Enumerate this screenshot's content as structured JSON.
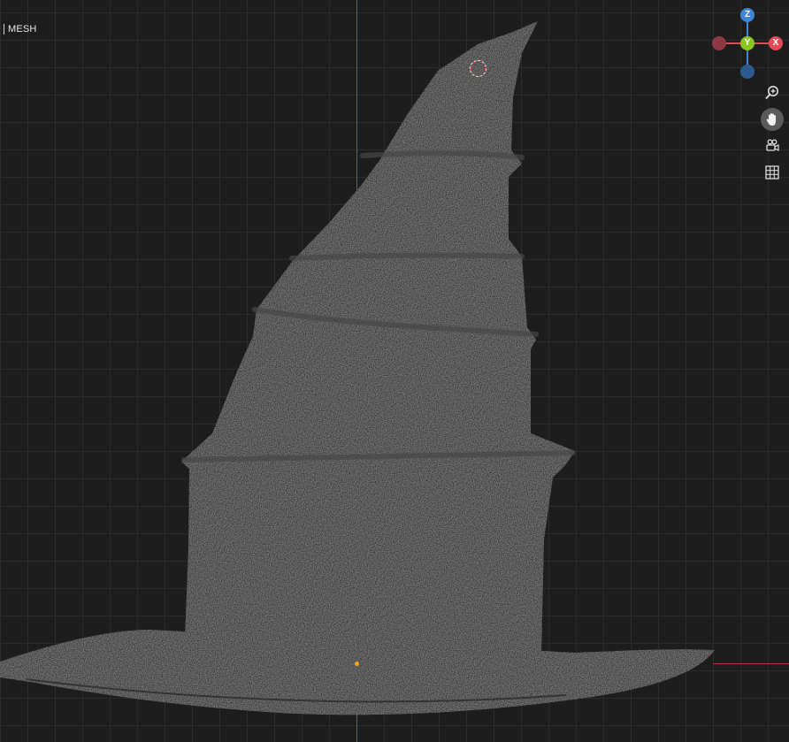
{
  "viewport": {
    "mode_label": "MESH",
    "colors": {
      "background": "#1d1d1d",
      "grid": "#2c2c2c",
      "z_axis": "#3a6bb0",
      "x_axis": "#b0364a",
      "mesh": "#3a3a3a",
      "origin": "#f4a11e"
    }
  },
  "gizmo": {
    "z_label": "Z",
    "y_label": "Y",
    "x_label": "X",
    "colors": {
      "x": "#e54857",
      "y": "#8ac520",
      "z": "#3d86d8"
    }
  },
  "tools": [
    {
      "name": "zoom",
      "icon": "zoom-in-icon"
    },
    {
      "name": "pan",
      "icon": "hand-icon",
      "active": true
    },
    {
      "name": "camera",
      "icon": "camera-icon"
    },
    {
      "name": "grid",
      "icon": "grid-icon"
    }
  ]
}
